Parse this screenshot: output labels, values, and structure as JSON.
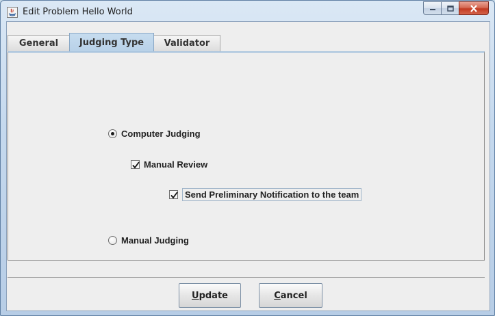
{
  "window": {
    "title": "Edit Problem Hello World"
  },
  "tabs": [
    {
      "label": "General",
      "active": false
    },
    {
      "label": "Judging Type",
      "active": true
    },
    {
      "label": "Validator",
      "active": false
    }
  ],
  "judging": {
    "computer_judging": {
      "label": "Computer Judging",
      "selected": true
    },
    "manual_review": {
      "label": "Manual Review",
      "checked": true
    },
    "send_preliminary": {
      "label": "Send Preliminary Notification to the team",
      "checked": true
    },
    "manual_judging": {
      "label": "Manual Judging",
      "selected": false
    }
  },
  "buttons": {
    "update_mnemonic": "U",
    "update_rest": "pdate",
    "cancel_mnemonic": "C",
    "cancel_rest": "ancel"
  },
  "colors": {
    "close_button": "#c23a22",
    "active_tab": "#b8d1e8",
    "panel_bg": "#eeeeee"
  }
}
